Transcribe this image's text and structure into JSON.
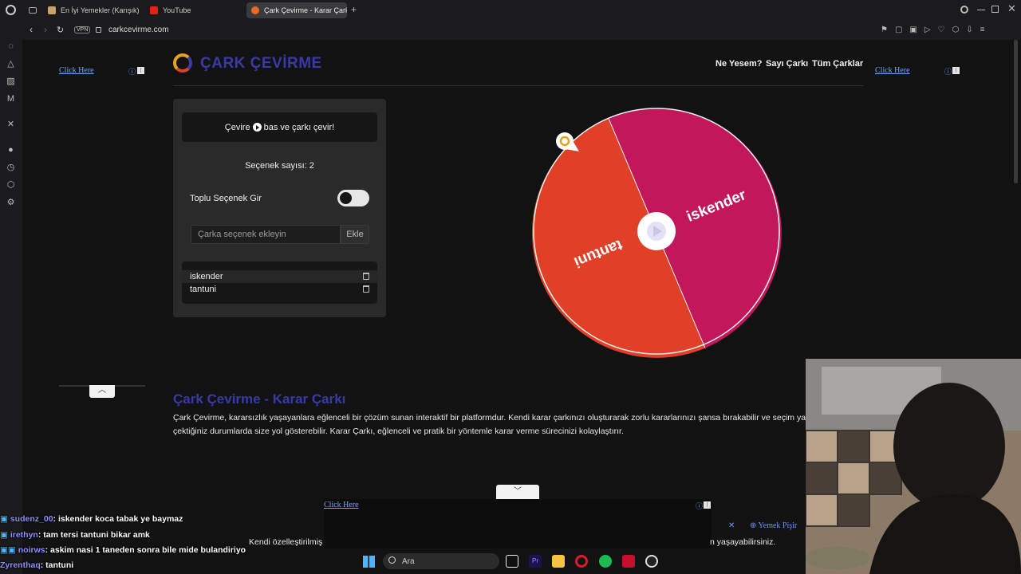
{
  "browser": {
    "tabs": [
      {
        "label": "En İyi Yemekler (Karışık)"
      },
      {
        "label": "YouTube"
      },
      {
        "label": "Çark Çevirme - Karar Çarkı"
      }
    ],
    "new_tab": "+",
    "vpn_badge": "VPN",
    "url": "carkcevirme.com"
  },
  "site": {
    "logo_text": "ÇARK ÇEVİRME",
    "nav": [
      "Ne Yesem?",
      "Sayı Çarkı",
      "Tüm Çarklar"
    ],
    "ad_link": "Click Here",
    "panel": {
      "spin_prefix": "Çevire",
      "spin_suffix": "bas ve çarkı çevir!",
      "option_count": "Seçenek sayısı: 2",
      "bulk_label": "Toplu Seçenek Gir",
      "bulk_enabled": false,
      "input_placeholder": "Çarka seçenek ekleyin",
      "add_label": "Ekle",
      "options": [
        "iskender",
        "tantuni"
      ]
    },
    "wheel": {
      "segments": [
        {
          "label": "iskender",
          "color": "#c2185b"
        },
        {
          "label": "tantuni",
          "color": "#e04027"
        }
      ]
    },
    "heading": "Çark Çevirme - Karar Çarkı",
    "body_text": "Çark Çevirme, kararsızlık yaşayanlara eğlenceli bir çözüm sunan interaktif bir platformdur. Kendi karar çarkınızı oluşturarak zorlu kararlarınızı şansa bırakabilir ve seçim yap",
    "body_text_2": "çektiğiniz durumlarda size yol gösterebilir. Karar Çarkı, eğlenceli ve pratik bir yöntemle karar verme sürecinizi kolaylaştırır.",
    "bottom_text_left": "Kendi özelleştirilmiş",
    "bottom_text_right": "n yaşayabilirsiniz.",
    "bottom_ad_link": "Yemek Pişir",
    "bottom_ad_close": "✕"
  },
  "chat": [
    {
      "user": "sudenz_00",
      "msg": ": iskender koca tabak ye baymaz"
    },
    {
      "user": "irethyn",
      "msg": ": tam tersi tantuni bikar amk"
    },
    {
      "user": "noirws",
      "msg": ": askim nasi 1 taneden sonra bile mide bulandiriyo"
    },
    {
      "user": "Zyrenthaq",
      "msg": ": tantuni"
    }
  ],
  "taskbar": {
    "search_placeholder": "Ara"
  },
  "colors": {
    "brand": "#3a3aa6",
    "pink": "#c2185b",
    "orange": "#e04027"
  }
}
